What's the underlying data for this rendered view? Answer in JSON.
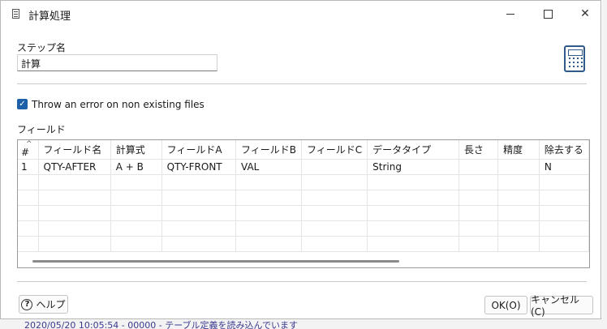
{
  "window": {
    "title": "計算処理"
  },
  "step": {
    "label": "ステップ名",
    "value": "計算"
  },
  "options": {
    "throw_error_label": "Throw an error on non existing files",
    "throw_error_checked": true
  },
  "fields": {
    "label": "フィールド",
    "columns": [
      "#",
      "フィールド名",
      "計算式",
      "フィールドA",
      "フィールドB",
      "フィールドC",
      "データタイプ",
      "長さ",
      "精度",
      "除去する"
    ],
    "rows": [
      [
        "1",
        "QTY-AFTER",
        "A + B",
        "QTY-FRONT",
        "VAL",
        "",
        "String",
        "",
        "",
        "N"
      ]
    ]
  },
  "buttons": {
    "help": "ヘルプ",
    "ok": "OK(O)",
    "cancel": "キャンセル(C)"
  },
  "background": {
    "bottom_text": "2020/05/20 10:05:54 - 00000 - テーブル定義を読み込んでいます"
  },
  "colors": {
    "accent": "#1d5fa8",
    "icon": "#2f5a8a"
  }
}
